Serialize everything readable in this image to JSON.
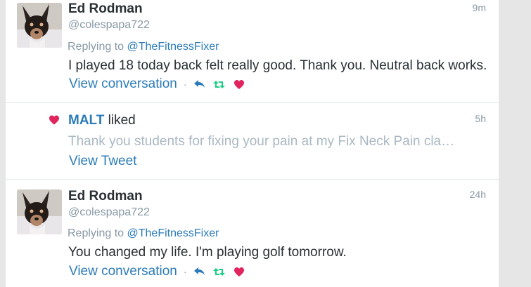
{
  "items": [
    {
      "name": "Ed Rodman",
      "handle": "@colespapa722",
      "time": "9m",
      "reply_prefix": "Replying to",
      "reply_to": "@TheFitnessFixer",
      "text": "I played 18 today back felt really good. Thank you. Neutral back works.",
      "view_conversation": "View conversation",
      "dot": "·"
    },
    {
      "liker": "MALT",
      "action": "liked",
      "time": "5h",
      "quoted_text": "Thank you students for fixing your pain at my Fix Neck Pain cla…",
      "view_tweet": "View Tweet"
    },
    {
      "name": "Ed Rodman",
      "handle": "@colespapa722",
      "time": "24h",
      "reply_prefix": "Replying to",
      "reply_to": "@TheFitnessFixer",
      "text": "You changed my life. I'm playing golf tomorrow.",
      "view_conversation": "View conversation",
      "dot": "·"
    }
  ],
  "icons": {
    "reply": "reply-icon",
    "retweet": "retweet-icon",
    "like": "heart-icon"
  },
  "colors": {
    "link": "#2b7bb9",
    "retweet": "#19cf86",
    "like": "#e0245e",
    "muted": "#8899a6"
  }
}
